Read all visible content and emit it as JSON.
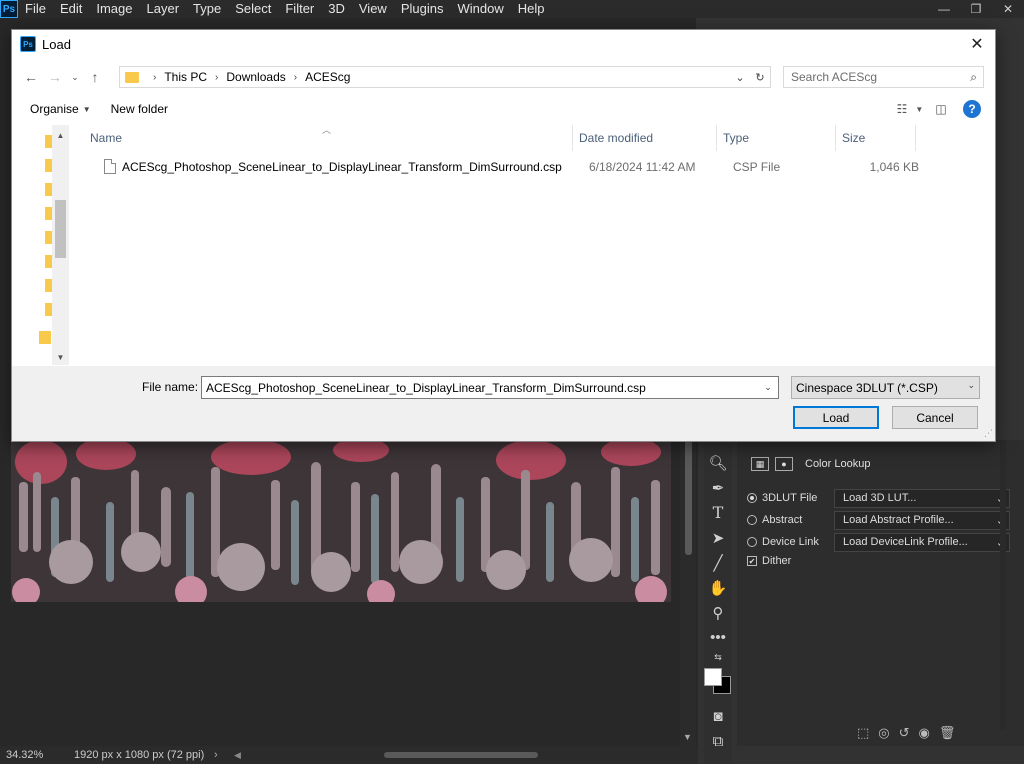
{
  "app": {
    "logo": "Ps",
    "menu": [
      "File",
      "Edit",
      "Image",
      "Layer",
      "Type",
      "Select",
      "Filter",
      "3D",
      "View",
      "Plugins",
      "Window",
      "Help"
    ],
    "win_controls": [
      "—",
      "❐",
      "✕"
    ]
  },
  "dialog": {
    "logo": "Ps",
    "title": "Load",
    "close": "✕",
    "breadcrumb": [
      "This PC",
      "Downloads",
      "ACEScg"
    ],
    "search_placeholder": "Search ACEScg",
    "organise_label": "Organise",
    "new_folder_label": "New folder",
    "help_label": "?",
    "columns": {
      "name": "Name",
      "date_modified": "Date modified",
      "type": "Type",
      "size": "Size"
    },
    "files": [
      {
        "name": "ACEScg_Photoshop_SceneLinear_to_DisplayLinear_Transform_DimSurround.csp",
        "date_modified": "6/18/2024 11:42 AM",
        "type": "CSP File",
        "size": "1,046 KB"
      }
    ],
    "file_name_label": "File name:",
    "file_name_value": "ACEScg_Photoshop_SceneLinear_to_DisplayLinear_Transform_DimSurround.csp",
    "file_type_value": "Cinespace 3DLUT (*.CSP)",
    "load_button": "Load",
    "cancel_button": "Cancel"
  },
  "properties": {
    "title": "Color Lookup",
    "rows": [
      {
        "label": "3DLUT File",
        "value": "Load 3D LUT..."
      },
      {
        "label": "Abstract",
        "value": "Load Abstract Profile..."
      },
      {
        "label": "Device Link",
        "value": "Load DeviceLink Profile..."
      }
    ],
    "dither_label": "Dither",
    "selected_row": 0,
    "dither_checked": true
  },
  "status": {
    "zoom": "34.32%",
    "dimensions": "1920 px x 1080 px (72 ppi)"
  }
}
